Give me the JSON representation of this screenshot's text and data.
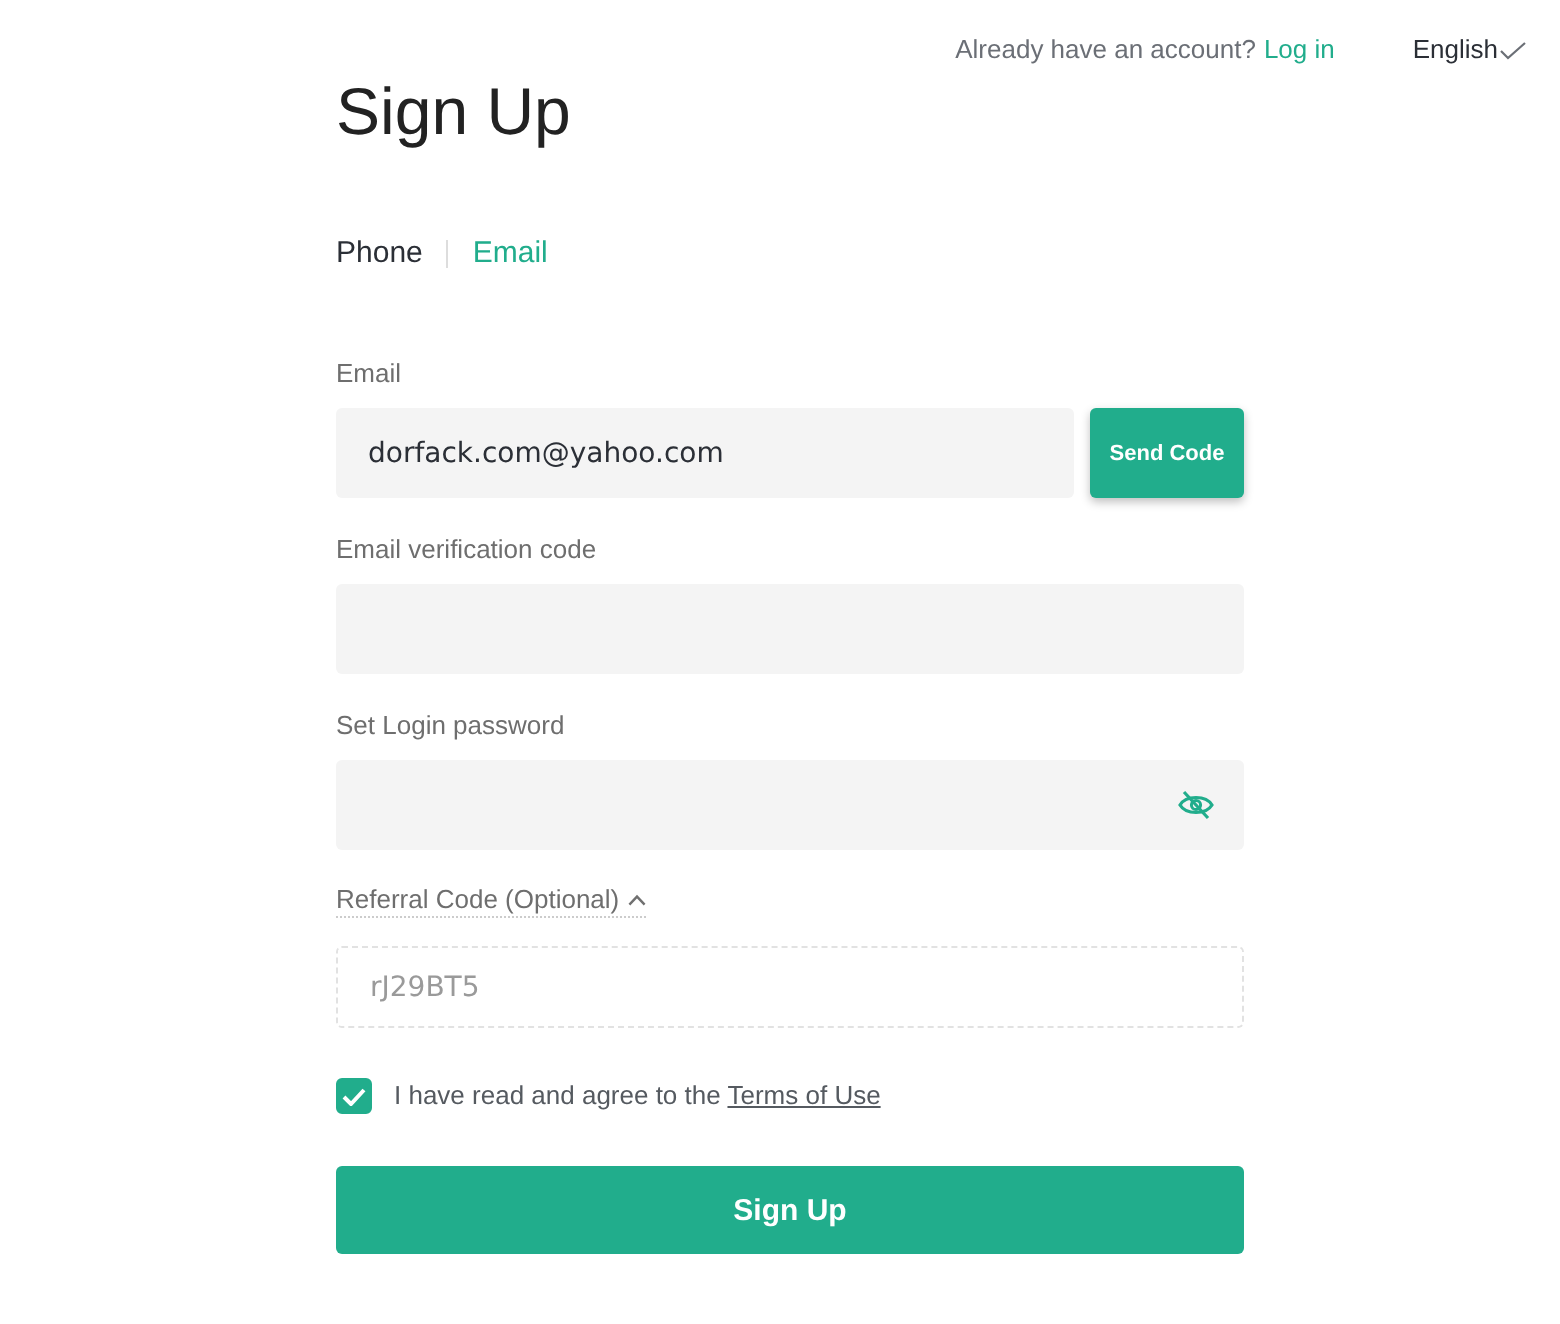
{
  "header": {
    "prompt": "Already have an account?",
    "login_link": "Log in",
    "language": "English"
  },
  "title": "Sign Up",
  "tabs": [
    {
      "label": "Phone",
      "selected": false
    },
    {
      "label": "Email",
      "selected": true
    }
  ],
  "fields": [
    {
      "kind": "email",
      "label": "Email",
      "value": "dorfack.com@yahoo.com",
      "button": "Send Code"
    },
    {
      "kind": "code",
      "label": "Email verification code"
    },
    {
      "kind": "password",
      "label": "Set Login password",
      "visible": false
    }
  ],
  "referral": {
    "label": "Referral Code (Optional)",
    "expanded": true,
    "value": "rJ29BT5"
  },
  "agreement": {
    "checked": true,
    "text": "I have read and agree to the",
    "link": "Terms of Use"
  },
  "submit": "Sign Up"
}
